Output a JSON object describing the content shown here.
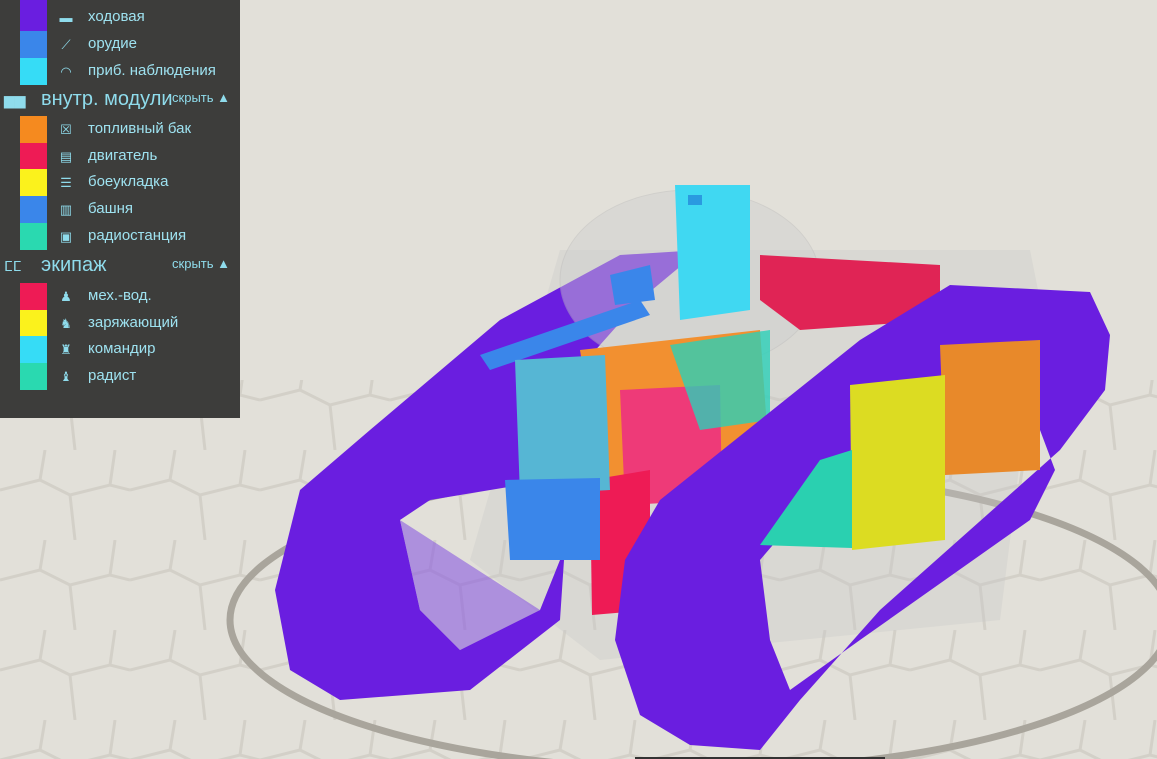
{
  "colors": {
    "tracks": "#6a1ee0",
    "gun": "#3a86ea",
    "observation": "#36dcf6",
    "fuel": "#f58a1f",
    "engine": "#ee1b55",
    "ammo": "#fbf21c",
    "turret": "#3a86ea",
    "radio": "#2ad9b0",
    "panel_bg": "#3d3d3b",
    "text": "#8fdcec"
  },
  "external": [
    {
      "label": "ходовая",
      "color": "#6a1ee0",
      "icon": "tracks-icon"
    },
    {
      "label": "орудие",
      "color": "#3a86ea",
      "icon": "gun-icon"
    },
    {
      "label": "приб. наблюдения",
      "color": "#36dcf6",
      "icon": "observation-icon"
    }
  ],
  "internal": {
    "title": "внутр. модули",
    "hide": "скрыть ▲",
    "items": [
      {
        "label": "топливный бак",
        "color": "#f58a1f",
        "icon": "fuel-tank-icon"
      },
      {
        "label": "двигатель",
        "color": "#ee1b55",
        "icon": "engine-icon"
      },
      {
        "label": "боеукладка",
        "color": "#fbf21c",
        "icon": "ammo-rack-icon"
      },
      {
        "label": "башня",
        "color": "#3a86ea",
        "icon": "turret-icon"
      },
      {
        "label": "радиостанция",
        "color": "#2ad9b0",
        "icon": "radio-icon"
      }
    ]
  },
  "crew": {
    "title": "экипаж",
    "hide": "скрыть ▲",
    "items": [
      {
        "label": "мех.-вод.",
        "color": "#ee1b55",
        "icon": "driver-icon"
      },
      {
        "label": "заряжающий",
        "color": "#fbf21c",
        "icon": "loader-icon"
      },
      {
        "label": "командир",
        "color": "#36dcf6",
        "icon": "commander-icon"
      },
      {
        "label": "радист",
        "color": "#2ad9b0",
        "icon": "radio-operator-icon"
      }
    ]
  }
}
